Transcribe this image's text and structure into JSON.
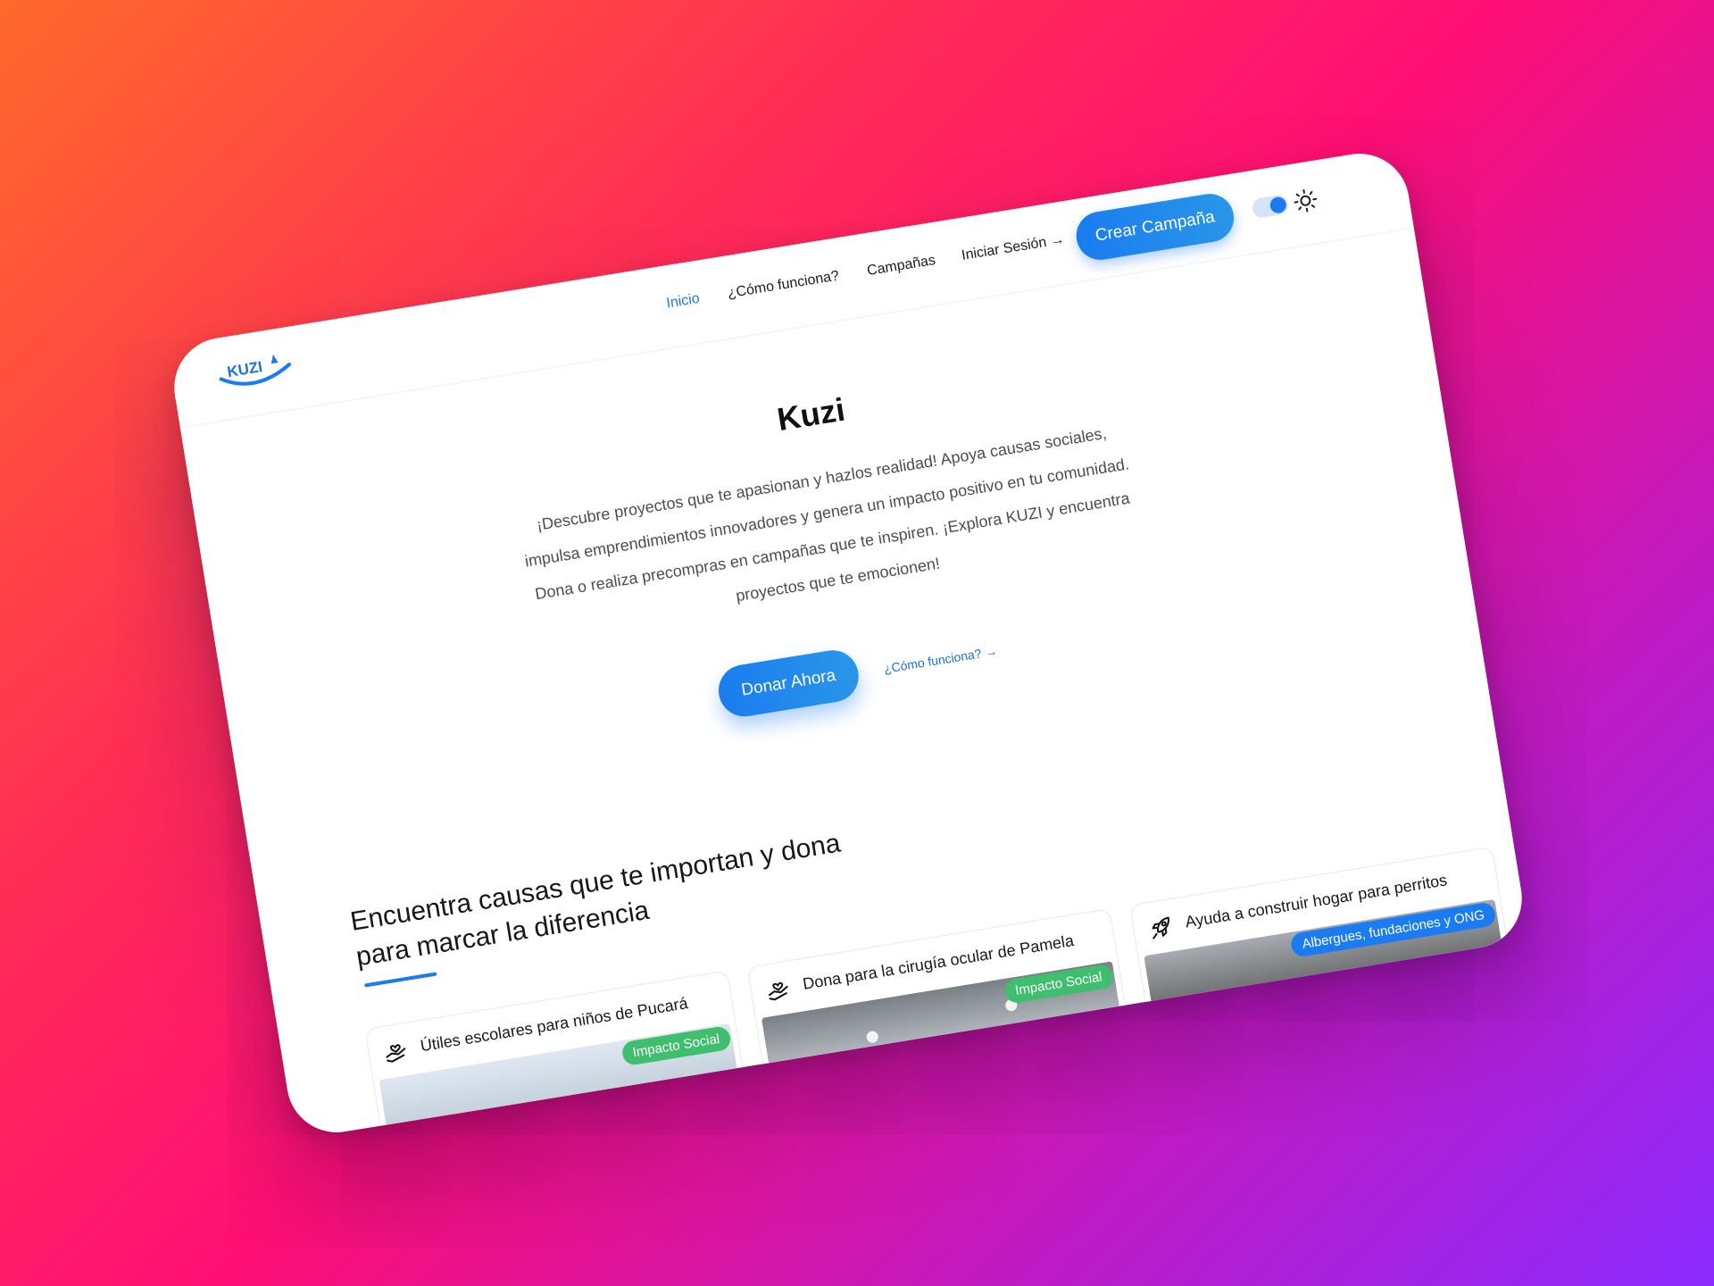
{
  "brand": {
    "logo_text": "KUZI",
    "accent": "#1A7CF0"
  },
  "nav": {
    "items": [
      {
        "label": "Inicio",
        "active": true
      },
      {
        "label": "¿Cómo funciona?",
        "active": false
      },
      {
        "label": "Campañas",
        "active": false
      }
    ],
    "login_label": "Iniciar Sesión →",
    "cta_label": "Crear Campaña",
    "theme_toggle_on": true,
    "theme_icon": "sun-icon"
  },
  "hero": {
    "title": "Kuzi",
    "text": "¡Descubre proyectos que te apasionan y hazlos realidad! Apoya causas sociales, impulsa emprendimientos innovadores y genera un impacto positivo en tu comunidad. Dona o realiza precompras en campañas que te inspiren. ¡Explora KUZI y encuentra proyectos que te emocionen!",
    "primary_button": "Donar Ahora",
    "secondary_link": "¿Cómo funciona? →"
  },
  "section": {
    "title": "Encuentra causas que te importan y dona para marcar la diferencia"
  },
  "cards": [
    {
      "icon": "hand-heart-icon",
      "title": "Útiles escolares para niños de Pucará",
      "badge": "Impacto Social",
      "badge_color": "#3FBF6E"
    },
    {
      "icon": "hand-heart-icon",
      "title": "Dona para la cirugía ocular de Pamela",
      "badge": "Impacto Social",
      "badge_color": "#3FBF6E"
    },
    {
      "icon": "rocket-icon",
      "title": "Ayuda a construir hogar para perritos",
      "badge": "Albergues, fundaciones y ONG",
      "badge_color": "#1A7CF0"
    }
  ]
}
